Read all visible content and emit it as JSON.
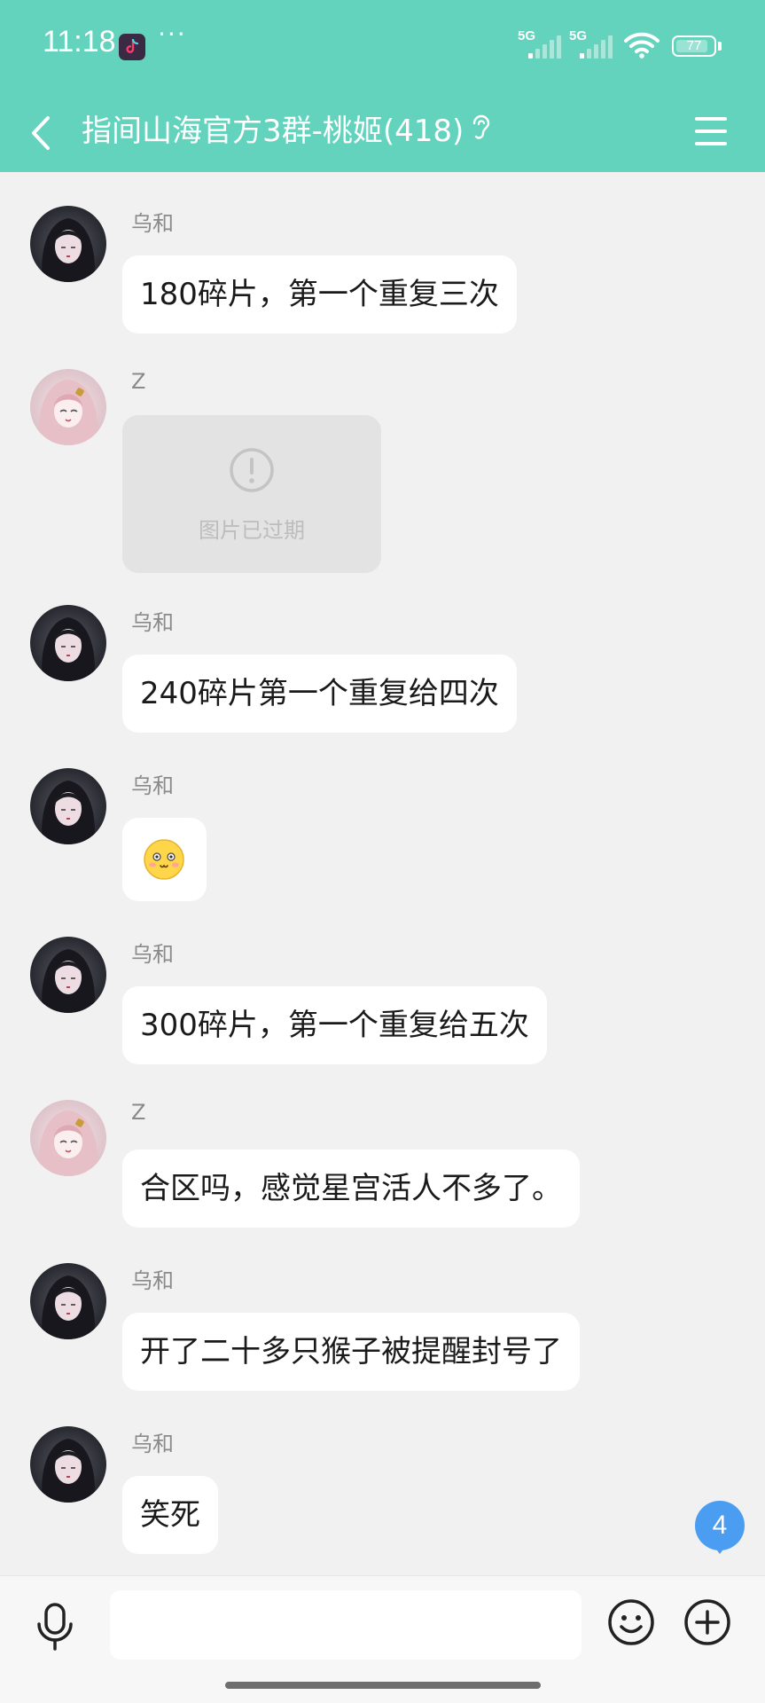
{
  "status_bar": {
    "time": "11:18",
    "more": "···",
    "signal_1": "5G",
    "signal_2": "5G",
    "battery": "77"
  },
  "header": {
    "title": "指间山海官方3群-桃姬(418)",
    "back_icon": "chevron-left-icon",
    "menu_icon": "menu-icon"
  },
  "colors": {
    "header_bg": "#64d3bd",
    "chat_bg": "#f1f1f1",
    "badge": "#4a9df0"
  },
  "messages": [
    {
      "sender": "乌和",
      "type": "text",
      "text": "180碎片，第一个重复三次"
    },
    {
      "sender": "Z",
      "type": "image-expired",
      "text": "图片已过期"
    },
    {
      "sender": "乌和",
      "type": "text",
      "text": "240碎片第一个重复给四次"
    },
    {
      "sender": "乌和",
      "type": "emoji",
      "emoji": "cute-face-emoji"
    },
    {
      "sender": "乌和",
      "type": "text",
      "text": "300碎片，第一个重复给五次"
    },
    {
      "sender": "Z",
      "type": "text",
      "text": "合区吗，感觉星宫活人不多了。"
    },
    {
      "sender": "乌和",
      "type": "text",
      "text": "开了二十多只猴子被提醒封号了"
    },
    {
      "sender": "乌和",
      "type": "text",
      "text": "笑死"
    }
  ],
  "unread_badge": "4",
  "input_bar": {
    "placeholder": "",
    "voice_icon": "microphone-icon",
    "emoji_icon": "smiley-icon",
    "plus_icon": "plus-circle-icon"
  }
}
